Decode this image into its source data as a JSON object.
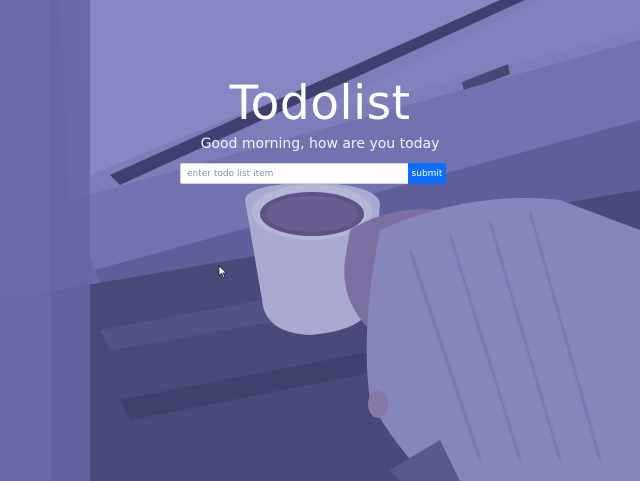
{
  "header": {
    "title": "Todolist",
    "greeting": "Good morning, how are you today"
  },
  "form": {
    "input_placeholder": "enter todo list item",
    "input_value": "",
    "submit_label": "submit"
  },
  "colors": {
    "overlay": "#6060aa",
    "submit_button": "#0d6efd"
  },
  "background": {
    "icon": "coffee-window-photo"
  }
}
